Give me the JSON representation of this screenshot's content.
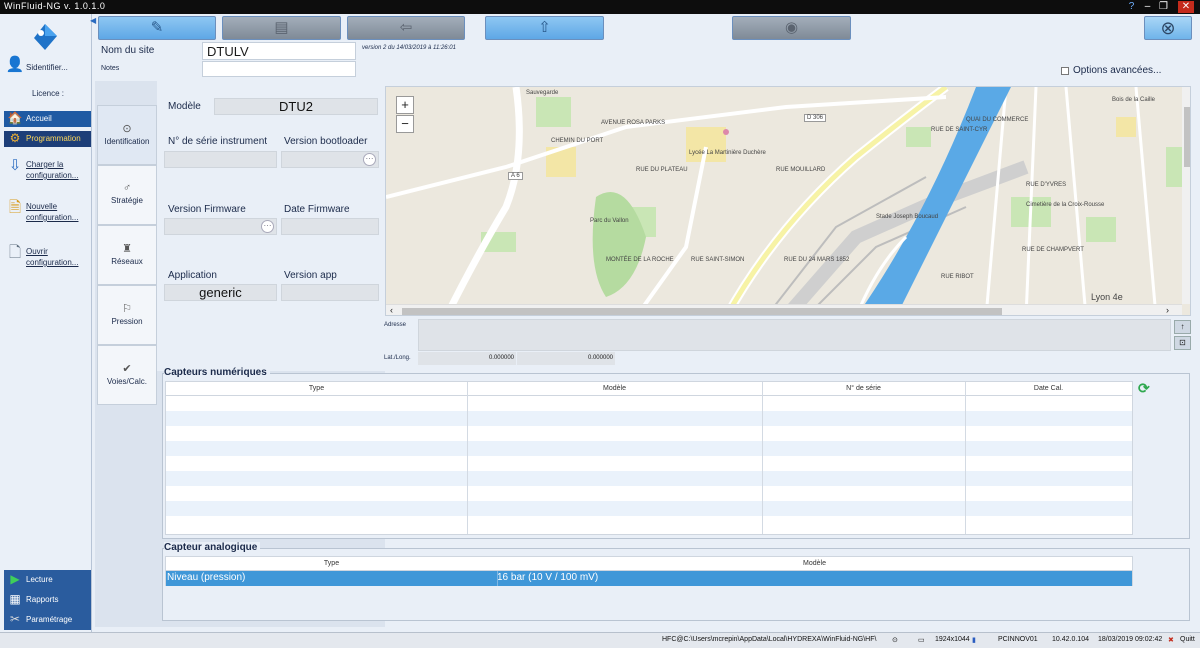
{
  "window": {
    "title": "WinFluid-NG v. 1.0.1.0"
  },
  "nav": {
    "identify": "Sidentifier...",
    "licence": "Licence :",
    "accueil": "Accueil",
    "programmation": "Programmation",
    "charger": [
      "Charger la",
      "configuration..."
    ],
    "nouvelle": [
      "Nouvelle",
      "configuration..."
    ],
    "ouvrir": [
      "Ouvrir",
      "configuration..."
    ],
    "lecture": "Lecture",
    "rapports": "Rapports",
    "parametrage": "Paramétrage"
  },
  "toolbar": {
    "edit": "✎",
    "save": "▤",
    "back": "⇦",
    "upload": "⇧",
    "disabled": "◉",
    "exit": "⊗"
  },
  "site": {
    "name_label": "Nom du site",
    "name_value": "DTULV",
    "version_text": "version 2 du 14/03/2019 à 11:26:01",
    "notes_label": "Notes",
    "notes_value": "",
    "advanced_label": "Options avancées..."
  },
  "tabs": [
    "Identification",
    "Stratégie",
    "Réseaux",
    "Pression",
    "Voies/Calc."
  ],
  "form": {
    "modele_label": "Modèle",
    "modele_value": "DTU2",
    "serie_label": "N° de série instrument",
    "serie_value": "",
    "bootloader_label": "Version bootloader",
    "bootloader_value": "",
    "firmware_label": "Version Firmware",
    "firmware_value": "",
    "date_fw_label": "Date Firmware",
    "date_fw_value": "",
    "application_label": "Application",
    "application_value": "generic",
    "version_app_label": "Version app",
    "version_app_value": "",
    "ellipsis": "···"
  },
  "map": {
    "zoom_in": "+",
    "zoom_out": "−",
    "labels": [
      "Sauvegarde",
      "AVENUE ROSA PARKS",
      "CHEMIN DU PORT",
      "RUE DU PLATEAU",
      "Lycée La Martinière Duchère",
      "A 6",
      "Parc du Vallon",
      "MONTÉE DE LA ROCHE",
      "RUE MOUILLARD",
      "D 306",
      "RUE DE SAINT-CYR",
      "QUAI DU COMMERCE",
      "Stade Joseph Boucaud",
      "RUE DU 24 MARS 1852",
      "Cimetière de la Croix-Rousse",
      "Bois de la Caille",
      "RUE D'YVRES",
      "RUE RIBOT",
      "Lyon 4e",
      "RUE DE CHAMPVERT",
      "RUE SAINT-SIMON"
    ],
    "address_label": "Adresse",
    "address_value": "",
    "latlong_label": "Lat./Long.",
    "lat": "0.000000",
    "long": "0.000000"
  },
  "capteurs_num": {
    "title": "Capteurs numériques",
    "columns": [
      "Type",
      "Modèle",
      "N° de série",
      "Date Cal."
    ],
    "rows": []
  },
  "capteur_ana": {
    "title": "Capteur analogique",
    "columns": [
      "Type",
      "Modèle"
    ],
    "rows": [
      {
        "type": "Niveau (pression)",
        "modele": "16 bar (10 V / 100 mV)"
      }
    ]
  },
  "status": {
    "path": "HFC@C:\\Users\\mcrepin\\AppData\\Local\\HYDREXA\\WinFluid-NG\\HF\\",
    "resolution": "1924x1044",
    "computer": "PCINNOV01",
    "ip": "10.42.0.104",
    "datetime": "18/03/2019  09:02:42",
    "quit": "Quitt"
  },
  "colors": {
    "accent": "#1f5aa3",
    "selection_row": "#3f97d8",
    "toolbar_active": "#5ea7e6",
    "water": "#5aa9e6"
  }
}
